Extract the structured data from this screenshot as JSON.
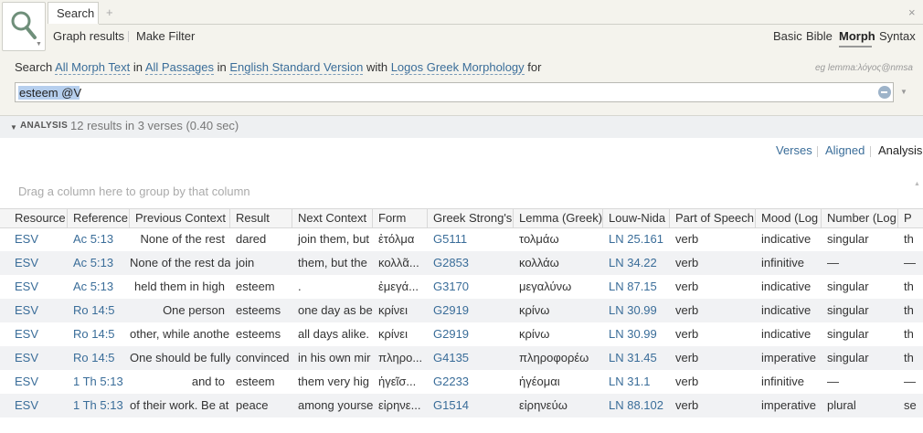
{
  "tab": {
    "label": "Search",
    "add_symbol": "+",
    "close_symbol": "×"
  },
  "toolbar": {
    "graph_results": "Graph results",
    "make_filter": "Make Filter"
  },
  "modes": [
    "Basic",
    "Bible",
    "Morph",
    "Syntax"
  ],
  "active_mode": "Morph",
  "query": {
    "t1": "Search ",
    "text_scope": "All Morph Text",
    "t2": " in ",
    "passages": "All Passages",
    "t3": " in ",
    "version": "English Standard Version",
    "t4": " with ",
    "morphology": "Logos Greek Morphology",
    "t5": " for",
    "hint": "eg lemma:λόγος@nmsa",
    "value": "esteem @V"
  },
  "analysis": {
    "title": "ANALYSIS",
    "count_text": "12 results in 3 verses (0.40 sec)"
  },
  "view_links": [
    "Verses",
    "Aligned",
    "Analysis"
  ],
  "active_view": "Analysis",
  "group_hint": "Drag a column here to group by that column",
  "columns": [
    "Resource",
    "Reference",
    "Previous Context",
    "Result",
    "Next Context",
    "Form",
    "Greek Strong's",
    "Lemma (Greek)",
    "Louw-Nida",
    "Part of Speech",
    "Mood (Log",
    "Number (Log",
    "P"
  ],
  "rows": [
    [
      "ESV",
      "Ac 5:13",
      "None of the rest",
      "dared",
      "join them, but",
      "ἐτόλμα",
      "G5111",
      "τολμάω",
      "LN 25.161",
      "verb",
      "indicative",
      "singular",
      "th"
    ],
    [
      "ESV",
      "Ac 5:13",
      "None of the rest dared",
      "join",
      "them, but the",
      "κολλᾶ...",
      "G2853",
      "κολλάω",
      "LN 34.22",
      "verb",
      "infinitive",
      "—",
      "—"
    ],
    [
      "ESV",
      "Ac 5:13",
      "held them in high",
      "esteem",
      ".",
      "ἐμεγά...",
      "G3170",
      "μεγαλύνω",
      "LN 87.15",
      "verb",
      "indicative",
      "singular",
      "th"
    ],
    [
      "ESV",
      "Ro 14:5",
      "One person",
      "esteems",
      "one day as be",
      "κρίνει",
      "G2919",
      "κρίνω",
      "LN 30.99",
      "verb",
      "indicative",
      "singular",
      "th"
    ],
    [
      "ESV",
      "Ro 14:5",
      "other, while another",
      "esteems",
      "all days alike.",
      "κρίνει",
      "G2919",
      "κρίνω",
      "LN 30.99",
      "verb",
      "indicative",
      "singular",
      "th"
    ],
    [
      "ESV",
      "Ro 14:5",
      "One should be fully",
      "convinced",
      "in his own mir",
      "πληρο...",
      "G4135",
      "πληροφορέω",
      "LN 31.45",
      "verb",
      "imperative",
      "singular",
      "th"
    ],
    [
      "ESV",
      "1 Th 5:13",
      "and to",
      "esteem",
      "them very hig",
      "ἡγεῖσ...",
      "G2233",
      "ἡγέομαι",
      "LN 31.1",
      "verb",
      "infinitive",
      "—",
      "—"
    ],
    [
      "ESV",
      "1 Th 5:13",
      "of their work. Be at",
      "peace",
      "among yourse",
      "εἰρηνε...",
      "G1514",
      "εἰρηνεύω",
      "LN 88.102",
      "verb",
      "imperative",
      "plural",
      "se"
    ]
  ],
  "link_color": "#3a6d99"
}
